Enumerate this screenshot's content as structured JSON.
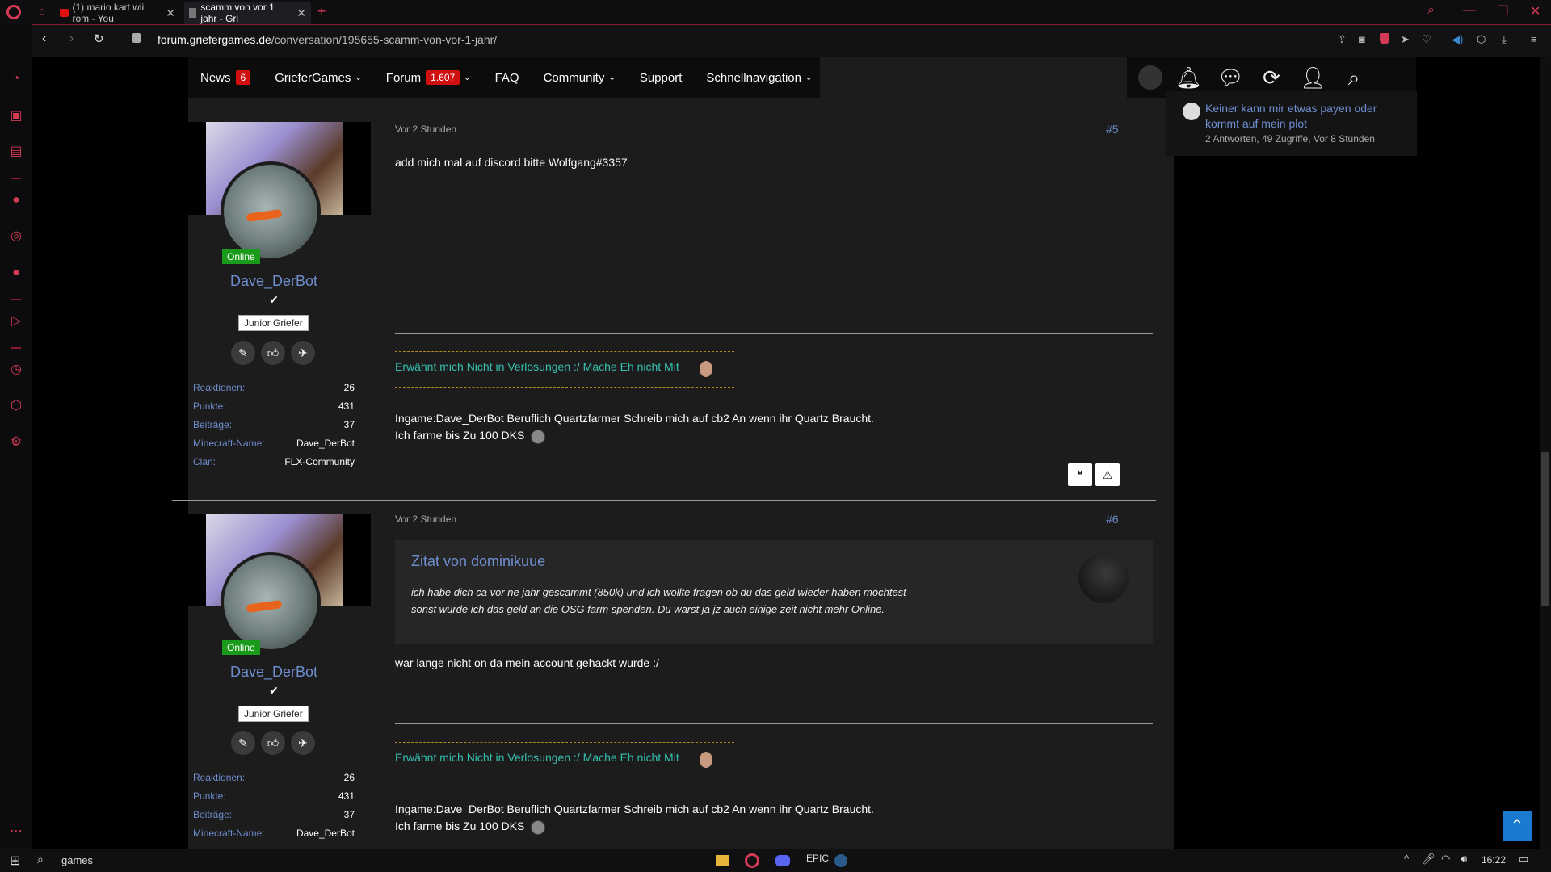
{
  "browser": {
    "tabs": [
      {
        "label": "(1) mario kart wii rom - You"
      },
      {
        "label": "scamm von vor 1 jahr - Gri"
      }
    ],
    "new_tab": "+",
    "url_domain": "forum.griefergames.de",
    "url_path": "/conversation/195655-scamm-von-vor-1-jahr/"
  },
  "nav": {
    "items": [
      {
        "label": "News",
        "badge": "6"
      },
      {
        "label": "GrieferGames",
        "chevron": "⌄"
      },
      {
        "label": "Forum",
        "badge": "1.607",
        "chevron": "⌄"
      },
      {
        "label": "FAQ"
      },
      {
        "label": "Community",
        "chevron": "⌄"
      },
      {
        "label": "Support"
      },
      {
        "label": "Schnellnavigation",
        "chevron": "⌄"
      }
    ]
  },
  "sidebar": {
    "thread_title": "Keiner kann mir etwas payen oder kommt auf mein plot",
    "thread_meta": "2 Antworten, 49 Zugriffe, Vor 8 Stunden"
  },
  "posts": [
    {
      "time": "Vor 2 Stunden",
      "number": "#5",
      "user": {
        "name": "Dave_DerBot",
        "status": "Online",
        "rank": "Junior Griefer",
        "stats": [
          {
            "label": "Reaktionen:",
            "value": "26"
          },
          {
            "label": "Punkte:",
            "value": "431"
          },
          {
            "label": "Beiträge:",
            "value": "37"
          },
          {
            "label": "Minecraft-Name:",
            "value": "Dave_DerBot"
          },
          {
            "label": "Clan:",
            "value": "FLX-Community"
          }
        ]
      },
      "text": "add mich mal auf discord bitte Wolfgang#3357",
      "signature": {
        "link": "Erwähnt mich Nicht in Verlosungen :/ Mache Eh nicht Mit",
        "line1": "Ingame:Dave_DerBot Beruflich Quartzfarmer Schreib mich auf cb2 An wenn ihr Quartz Braucht.",
        "line2": "Ich farme bis Zu 100 DKS"
      }
    },
    {
      "time": "Vor 2 Stunden",
      "number": "#6",
      "user": {
        "name": "Dave_DerBot",
        "status": "Online",
        "rank": "Junior Griefer",
        "stats": [
          {
            "label": "Reaktionen:",
            "value": "26"
          },
          {
            "label": "Punkte:",
            "value": "431"
          },
          {
            "label": "Beiträge:",
            "value": "37"
          },
          {
            "label": "Minecraft-Name:",
            "value": "Dave_DerBot"
          }
        ]
      },
      "quote": {
        "title": "Zitat von dominikuue",
        "line1": "ich habe dich ca vor ne jahr gescammt (850k) und ich wollte fragen ob du das geld wieder haben möchtest",
        "line2": "sonst würde ich das geld an die OSG farm spenden. Du warst ja jz auch einige zeit nicht mehr Online."
      },
      "text": "war lange nicht on da mein account gehackt wurde :/",
      "signature": {
        "link": "Erwähnt mich Nicht in Verlosungen :/ Mache Eh nicht Mit",
        "line1": "Ingame:Dave_DerBot Beruflich Quartzfarmer Schreib mich auf cb2 An wenn ihr Quartz Braucht.",
        "line2": "Ich farme bis Zu 100 DKS"
      }
    }
  ],
  "taskbar": {
    "search_text": "games",
    "time": "16:22"
  }
}
